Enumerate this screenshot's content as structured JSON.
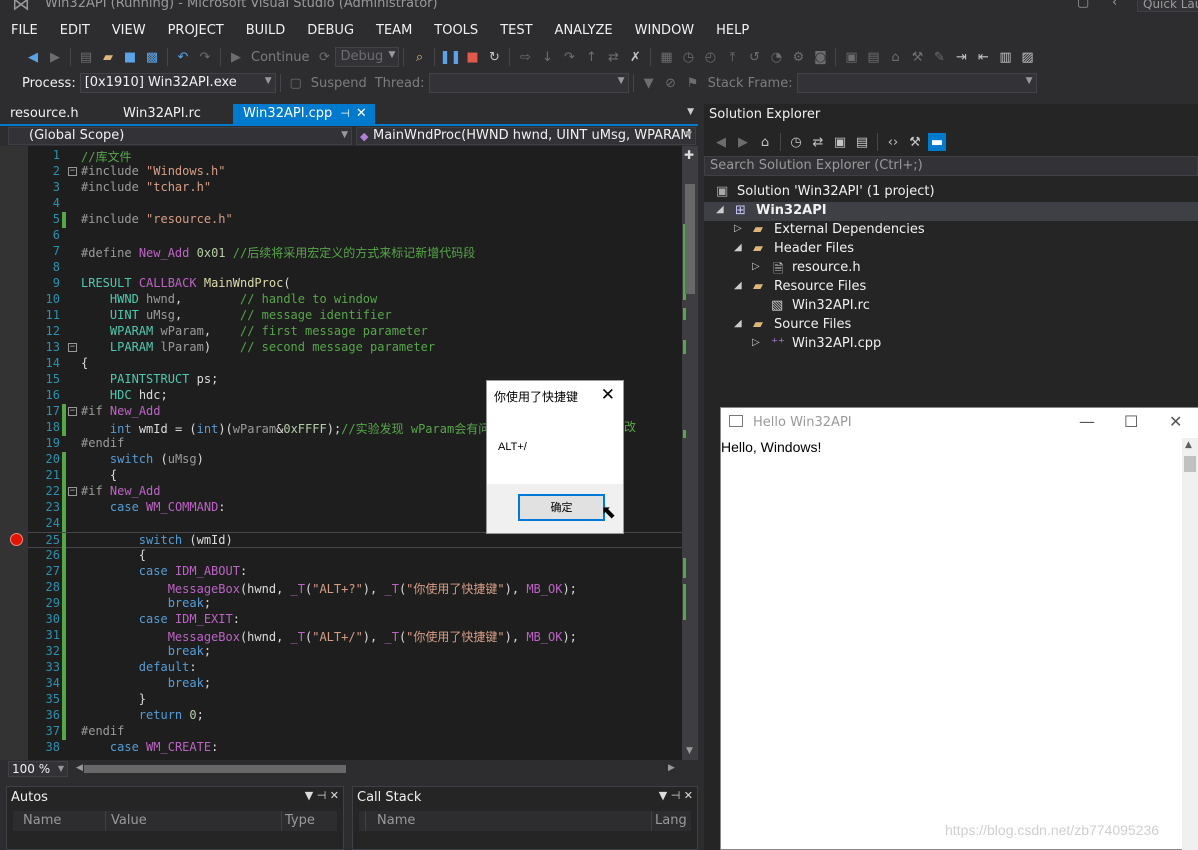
{
  "window": {
    "title": "Win32API (Running) - Microsoft Visual Studio (Administrator)",
    "quick_launch": "Quick Lau"
  },
  "menu": [
    "FILE",
    "EDIT",
    "VIEW",
    "PROJECT",
    "BUILD",
    "DEBUG",
    "TEAM",
    "TOOLS",
    "TEST",
    "ANALYZE",
    "WINDOW",
    "HELP"
  ],
  "toolbar": {
    "continue_label": "Continue",
    "config": "Debug",
    "process_label": "Process:",
    "process_value": "[0x1910] Win32API.exe",
    "suspend_label": "Suspend",
    "thread_label": "Thread:",
    "stack_frame_label": "Stack Frame:"
  },
  "editor": {
    "tabs": [
      {
        "label": "resource.h"
      },
      {
        "label": "Win32API.rc"
      },
      {
        "label": "Win32API.cpp"
      }
    ],
    "scope": "(Global Scope)",
    "function": "MainWndProc(HWND hwnd, UINT uMsg, WPARAM w",
    "zoom": "100 %",
    "code_lines": [
      {
        "n": "1",
        "html": "<span class='c'>//库文件</span>"
      },
      {
        "n": "2",
        "html": "<span class='p'>#include</span> <span class='s'>\"Windows.h\"</span>"
      },
      {
        "n": "3",
        "html": "<span class='p'>#include</span> <span class='s'>\"tchar.h\"</span>"
      },
      {
        "n": "4",
        "html": ""
      },
      {
        "n": "5",
        "html": "<span class='p'>#include</span> <span class='s'>\"resource.h\"</span>"
      },
      {
        "n": "6",
        "html": ""
      },
      {
        "n": "7",
        "html": "<span class='p'>#define</span> <span class='m'>New_Add</span> <span class='n'>0x01</span> <span class='c'>//后续将采用宏定义的方式来标记新增代码段</span>"
      },
      {
        "n": "8",
        "html": ""
      },
      {
        "n": "9",
        "html": "<span class='t'>LRESULT</span> <span class='m'>CALLBACK</span> <span class='f'>MainWndProc</span>("
      },
      {
        "n": "10",
        "html": "    <span class='t'>HWND</span> <span class='p'>hwnd</span>,        <span class='c'>// handle to window</span>"
      },
      {
        "n": "11",
        "html": "    <span class='t'>UINT</span> <span class='p'>uMsg</span>,        <span class='c'>// message identifier</span>"
      },
      {
        "n": "12",
        "html": "    <span class='t'>WPARAM</span> <span class='p'>wParam</span>,    <span class='c'>// first message parameter</span>"
      },
      {
        "n": "13",
        "html": "    <span class='t'>LPARAM</span> <span class='p'>lParam</span>)    <span class='c'>// second message parameter</span>"
      },
      {
        "n": "14",
        "html": "{"
      },
      {
        "n": "15",
        "html": "    <span class='t'>PAINTSTRUCT</span> ps;"
      },
      {
        "n": "16",
        "html": "    <span class='t'>HDC</span> hdc;"
      },
      {
        "n": "17",
        "html": "<span class='p'>#if</span> <span class='m'>New_Add</span>"
      },
      {
        "n": "18",
        "html": "    <span class='k'>int</span> wmId = (<span class='k'>int</span>)(<span class='p'>wParam</span>&amp;<span class='n'>0xFFFF</span>);<span class='c'>//实验发现 wParam会有问</span>"
      },
      {
        "n": "19",
        "html": "<span class='p'>#endif</span>"
      },
      {
        "n": "20",
        "html": "    <span class='k'>switch</span> (<span class='p'>uMsg</span>)"
      },
      {
        "n": "21",
        "html": "    {"
      },
      {
        "n": "22",
        "html": "<span class='p'>#if</span> <span class='m'>New_Add</span>"
      },
      {
        "n": "23",
        "html": "    <span class='k'>case</span> <span class='m'>WM_COMMAND</span>:"
      },
      {
        "n": "24",
        "html": ""
      },
      {
        "n": "25",
        "html": "        <span class='k'>switch</span> (wmId)"
      },
      {
        "n": "26",
        "html": "        {"
      },
      {
        "n": "27",
        "html": "        <span class='k'>case</span> <span class='m'>IDM_ABOUT</span>:"
      },
      {
        "n": "28",
        "html": "            <span class='m'>MessageBox</span>(hwnd, <span class='m'>_T</span>(<span class='s'>\"ALT+?\"</span>), <span class='m'>_T</span>(<span class='s'>\"你使用了快捷键\"</span>), <span class='m'>MB_OK</span>);"
      },
      {
        "n": "29",
        "html": "            <span class='k'>break</span>;"
      },
      {
        "n": "30",
        "html": "        <span class='k'>case</span> <span class='m'>IDM_EXIT</span>:"
      },
      {
        "n": "31",
        "html": "            <span class='m'>MessageBox</span>(hwnd, <span class='m'>_T</span>(<span class='s'>\"ALT+/\"</span>), <span class='m'>_T</span>(<span class='s'>\"你使用了快捷键\"</span>), <span class='m'>MB_OK</span>);"
      },
      {
        "n": "32",
        "html": "            <span class='k'>break</span>;"
      },
      {
        "n": "33",
        "html": "        <span class='k'>default</span>:"
      },
      {
        "n": "34",
        "html": "            <span class='k'>break</span>;"
      },
      {
        "n": "35",
        "html": "        }"
      },
      {
        "n": "36",
        "html": "        <span class='k'>return</span> <span class='n'>0</span>;"
      },
      {
        "n": "37",
        "html": "<span class='p'>#endif</span>"
      },
      {
        "n": "38",
        "html": "    <span class='k'>case</span> <span class='m'>WM_CREATE</span>:"
      }
    ]
  },
  "panels": {
    "autos": {
      "title": "Autos",
      "cols": [
        "Name",
        "Value",
        "Type"
      ]
    },
    "callstack": {
      "title": "Call Stack",
      "cols": [
        "Name",
        "Lang"
      ]
    }
  },
  "solution_explorer": {
    "title": "Solution Explorer",
    "search_placeholder": "Search Solution Explorer (Ctrl+;)",
    "tree": [
      {
        "label": "Solution 'Win32API' (1 project)"
      },
      {
        "label": "Win32API"
      },
      {
        "label": "External Dependencies"
      },
      {
        "label": "Header Files"
      },
      {
        "label": "resource.h"
      },
      {
        "label": "Resource Files"
      },
      {
        "label": "Win32API.rc"
      },
      {
        "label": "Source Files"
      },
      {
        "label": "Win32API.cpp"
      }
    ]
  },
  "hello_window": {
    "title": "Hello Win32API",
    "content": "Hello, Windows!"
  },
  "message_box": {
    "title": "你使用了快捷键",
    "text": "ALT+/",
    "ok_label": "确定"
  },
  "code_overflow_tail": "改",
  "watermark": "https://blog.csdn.net/zb774095236"
}
